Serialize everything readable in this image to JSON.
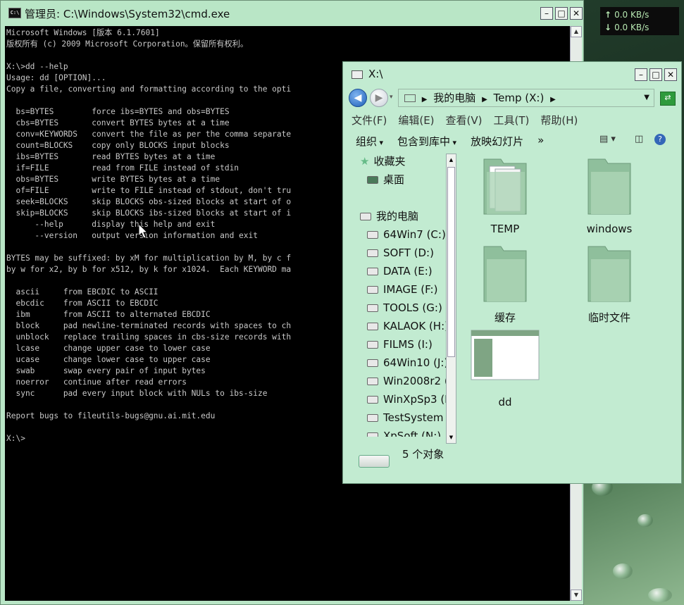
{
  "net_speed": {
    "up": "0.0 KB/s",
    "down": "0.0 KB/s",
    "up_arrow": "↑",
    "down_arrow": "↓"
  },
  "cmd_window": {
    "title": "管理员: C:\\Windows\\System32\\cmd.exe",
    "icon_label": "C:\\",
    "lines": [
      "Microsoft Windows [版本 6.1.7601]",
      "版权所有 (c) 2009 Microsoft Corporation。保留所有权利。",
      "",
      "X:\\>dd --help",
      "Usage: dd [OPTION]...",
      "Copy a file, converting and formatting according to the opti",
      "",
      "  bs=BYTES        force ibs=BYTES and obs=BYTES",
      "  cbs=BYTES       convert BYTES bytes at a time",
      "  conv=KEYWORDS   convert the file as per the comma separate",
      "  count=BLOCKS    copy only BLOCKS input blocks",
      "  ibs=BYTES       read BYTES bytes at a time",
      "  if=FILE         read from FILE instead of stdin",
      "  obs=BYTES       write BYTES bytes at a time",
      "  of=FILE         write to FILE instead of stdout, don't tru",
      "  seek=BLOCKS     skip BLOCKS obs-sized blocks at start of o",
      "  skip=BLOCKS     skip BLOCKS ibs-sized blocks at start of i",
      "      --help      display this help and exit",
      "      --version   output version information and exit",
      "",
      "BYTES may be suffixed: by xM for multiplication by M, by c f",
      "by w for x2, by b for x512, by k for x1024.  Each KEYWORD ma",
      "",
      "  ascii     from EBCDIC to ASCII",
      "  ebcdic    from ASCII to EBCDIC",
      "  ibm       from ASCII to alternated EBCDIC",
      "  block     pad newline-terminated records with spaces to ch",
      "  unblock   replace trailing spaces in cbs-size records with",
      "  lcase     change upper case to lower case",
      "  ucase     change lower case to upper case",
      "  swab      swap every pair of input bytes",
      "  noerror   continue after read errors",
      "  sync      pad every input block with NULs to ibs-size",
      "",
      "Report bugs to fileutils-bugs@gnu.ai.mit.edu",
      "",
      "X:\\>"
    ]
  },
  "explorer": {
    "title": "X:\\",
    "address": [
      "我的电脑",
      "Temp (X:)"
    ],
    "menu": [
      "文件(F)",
      "编辑(E)",
      "查看(V)",
      "工具(T)",
      "帮助(H)"
    ],
    "toolbar": [
      "组织",
      "包含到库中",
      "放映幻灯片",
      "»"
    ],
    "nav": [
      {
        "label": "收藏夹",
        "icon": "star-icon"
      },
      {
        "label": "桌面",
        "icon": "desktop-icon"
      },
      {
        "label": "",
        "icon": ""
      },
      {
        "label": "我的电脑",
        "icon": "computer-icon"
      },
      {
        "label": "64Win7 (C:)",
        "icon": "drive-icon"
      },
      {
        "label": "SOFT (D:)",
        "icon": "drive-icon"
      },
      {
        "label": "DATA (E:)",
        "icon": "drive-icon"
      },
      {
        "label": "IMAGE (F:)",
        "icon": "drive-icon"
      },
      {
        "label": "TOOLS (G:)",
        "icon": "drive-icon"
      },
      {
        "label": "KALAOK (H:)",
        "icon": "drive-icon"
      },
      {
        "label": "FILMS (I:)",
        "icon": "drive-icon"
      },
      {
        "label": "64Win10 (J:)",
        "icon": "drive-icon"
      },
      {
        "label": "Win2008r2 (",
        "icon": "drive-icon"
      },
      {
        "label": "WinXpSp3 (I",
        "icon": "drive-icon"
      },
      {
        "label": "TestSystem",
        "icon": "drive-icon"
      },
      {
        "label": "XpSoft (N:)",
        "icon": "drive-icon"
      }
    ],
    "files": [
      {
        "name": "TEMP",
        "type": "folder"
      },
      {
        "name": "windows",
        "type": "folder"
      },
      {
        "name": "缓存",
        "type": "folder"
      },
      {
        "name": "临时文件",
        "type": "folder"
      },
      {
        "name": "dd",
        "type": "application"
      }
    ],
    "status": "5 个对象"
  },
  "colors": {
    "window_tint": "#c2ebd1",
    "console_bg": "#000000",
    "console_fg": "#c8c8c8"
  }
}
